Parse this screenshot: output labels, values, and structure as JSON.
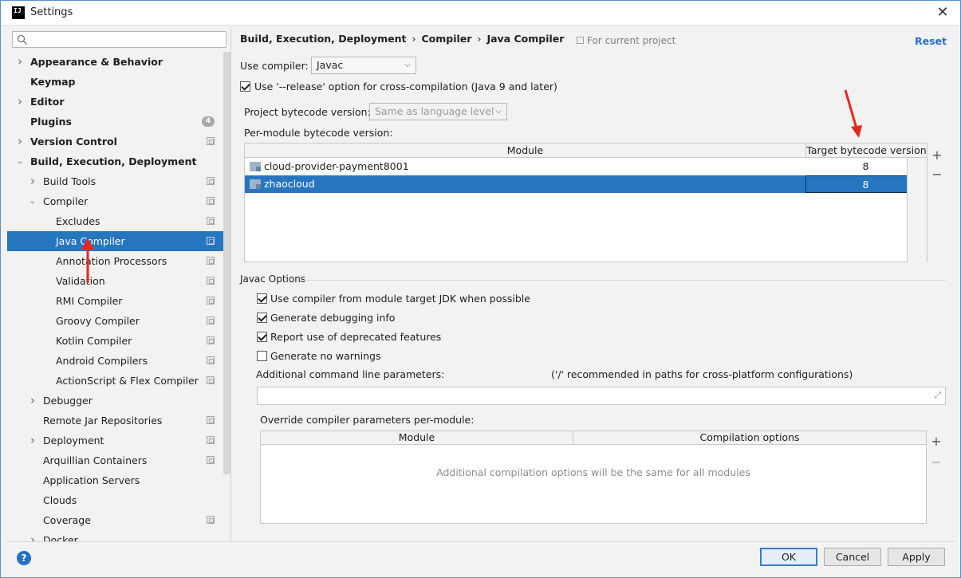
{
  "window": {
    "title": "Settings",
    "app_icon": "IJ"
  },
  "search": {
    "placeholder": ""
  },
  "sidebar": {
    "items": [
      {
        "label": "Appearance & Behavior",
        "bold": true,
        "arrow": "right",
        "indent": 0
      },
      {
        "label": "Keymap",
        "bold": true,
        "arrow": "",
        "indent": 0
      },
      {
        "label": "Editor",
        "bold": true,
        "arrow": "right",
        "indent": 0
      },
      {
        "label": "Plugins",
        "bold": true,
        "arrow": "",
        "indent": 0,
        "badge": "4"
      },
      {
        "label": "Version Control",
        "bold": true,
        "arrow": "right",
        "indent": 0,
        "project": true
      },
      {
        "label": "Build, Execution, Deployment",
        "bold": true,
        "arrow": "down",
        "indent": 0
      },
      {
        "label": "Build Tools",
        "bold": false,
        "arrow": "right",
        "indent": 1,
        "project": true
      },
      {
        "label": "Compiler",
        "bold": false,
        "arrow": "down",
        "indent": 1,
        "project": true
      },
      {
        "label": "Excludes",
        "bold": false,
        "arrow": "",
        "indent": 2,
        "project": true
      },
      {
        "label": "Java Compiler",
        "bold": false,
        "arrow": "",
        "indent": 2,
        "project": true,
        "selected": true
      },
      {
        "label": "Annotation Processors",
        "bold": false,
        "arrow": "",
        "indent": 2,
        "project": true
      },
      {
        "label": "Validation",
        "bold": false,
        "arrow": "",
        "indent": 2,
        "project": true
      },
      {
        "label": "RMI Compiler",
        "bold": false,
        "arrow": "",
        "indent": 2,
        "project": true
      },
      {
        "label": "Groovy Compiler",
        "bold": false,
        "arrow": "",
        "indent": 2,
        "project": true
      },
      {
        "label": "Kotlin Compiler",
        "bold": false,
        "arrow": "",
        "indent": 2,
        "project": true
      },
      {
        "label": "Android Compilers",
        "bold": false,
        "arrow": "",
        "indent": 2,
        "project": true
      },
      {
        "label": "ActionScript & Flex Compiler",
        "bold": false,
        "arrow": "",
        "indent": 2,
        "project": true
      },
      {
        "label": "Debugger",
        "bold": false,
        "arrow": "right",
        "indent": 1
      },
      {
        "label": "Remote Jar Repositories",
        "bold": false,
        "arrow": "",
        "indent": 1,
        "project": true
      },
      {
        "label": "Deployment",
        "bold": false,
        "arrow": "right",
        "indent": 1,
        "project": true
      },
      {
        "label": "Arquillian Containers",
        "bold": false,
        "arrow": "",
        "indent": 1,
        "project": true
      },
      {
        "label": "Application Servers",
        "bold": false,
        "arrow": "",
        "indent": 1
      },
      {
        "label": "Clouds",
        "bold": false,
        "arrow": "",
        "indent": 1
      },
      {
        "label": "Coverage",
        "bold": false,
        "arrow": "",
        "indent": 1,
        "project": true
      },
      {
        "label": "Docker",
        "bold": false,
        "arrow": "right",
        "indent": 1
      }
    ]
  },
  "header": {
    "crumbs": [
      "Build, Execution, Deployment",
      "Compiler",
      "Java Compiler"
    ],
    "for_project": "For current project",
    "reset": "Reset"
  },
  "compiler": {
    "use_compiler_label": "Use compiler:",
    "use_compiler_value": "Javac",
    "release_option_label": "Use '--release' option for cross-compilation (Java 9 and later)",
    "release_option_checked": true,
    "project_bytecode_label": "Project bytecode version:",
    "project_bytecode_value": "Same as language level",
    "per_module_label": "Per-module bytecode version:"
  },
  "bytecode_table": {
    "columns": [
      "Module",
      "Target bytecode version"
    ],
    "rows": [
      {
        "module": "cloud-provider-payment8001",
        "version": "8",
        "selected": false
      },
      {
        "module": "zhaocloud",
        "version": "8",
        "selected": true
      }
    ],
    "add": "+",
    "remove": "−"
  },
  "javac": {
    "group_title": "Javac Options",
    "options": [
      {
        "label": "Use compiler from module target JDK when possible",
        "checked": true
      },
      {
        "label": "Generate debugging info",
        "checked": true
      },
      {
        "label": "Report use of deprecated features",
        "checked": true
      },
      {
        "label": "Generate no warnings",
        "checked": false
      }
    ],
    "additional_label": "Additional command line parameters:",
    "additional_hint": "('/' recommended in paths for cross-platform configurations)",
    "additional_value": "",
    "override_label": "Override compiler parameters per-module:"
  },
  "override_table": {
    "columns": [
      "Module",
      "Compilation options"
    ],
    "empty_text": "Additional compilation options will be the same for all modules",
    "add": "+",
    "remove": "−"
  },
  "footer": {
    "help": "?",
    "ok": "OK",
    "cancel": "Cancel",
    "apply": "Apply"
  },
  "colors": {
    "selection": "#2675bf",
    "link": "#2470c7",
    "annotation_arrow": "#e8261e"
  }
}
